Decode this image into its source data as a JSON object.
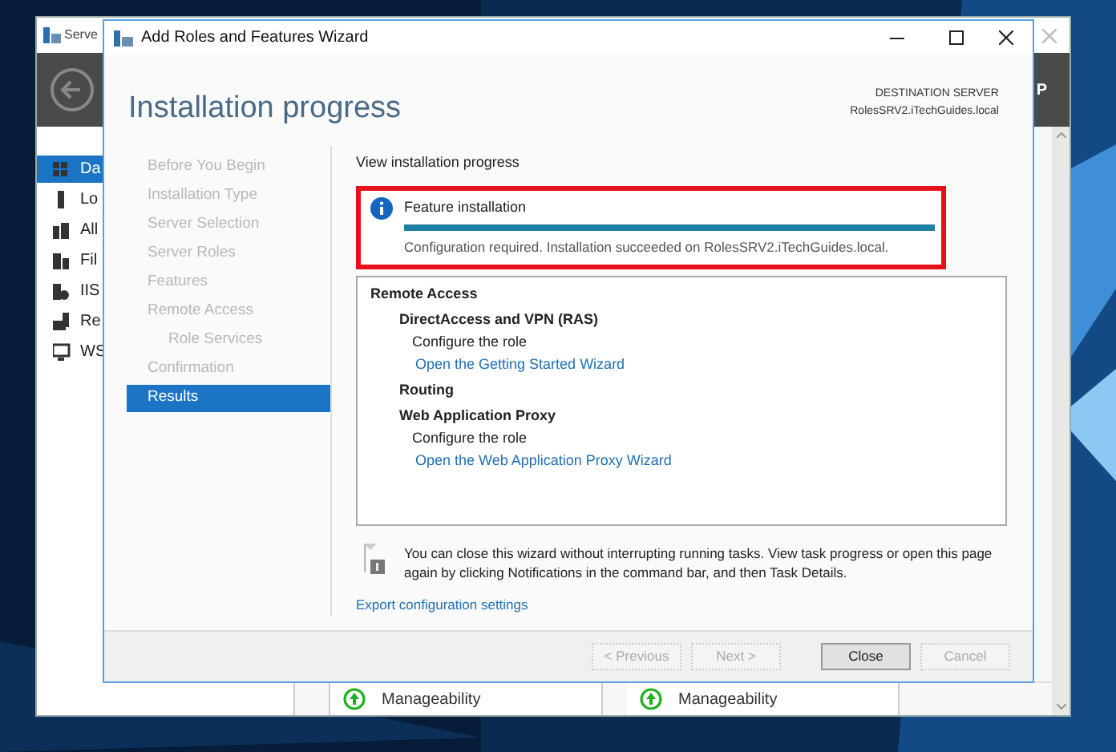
{
  "background_window": {
    "title": "Serve",
    "header_text": "P",
    "sidebar": [
      {
        "label": "Da",
        "selected": true
      },
      {
        "label": "Lo",
        "selected": false
      },
      {
        "label": "All",
        "selected": false
      },
      {
        "label": "Fil",
        "selected": false
      },
      {
        "label": "IIS",
        "selected": false
      },
      {
        "label": "Re",
        "selected": false
      },
      {
        "label": "WS",
        "selected": false
      }
    ],
    "tiles": [
      "Manageability",
      "Manageability"
    ]
  },
  "wizard": {
    "title": "Add Roles and Features Wizard",
    "heading": "Installation progress",
    "destination_label": "DESTINATION SERVER",
    "destination_server": "RolesSRV2.iTechGuides.local",
    "steps": [
      {
        "label": "Before You Begin",
        "selected": false
      },
      {
        "label": "Installation Type",
        "selected": false
      },
      {
        "label": "Server Selection",
        "selected": false
      },
      {
        "label": "Server Roles",
        "selected": false
      },
      {
        "label": "Features",
        "selected": false
      },
      {
        "label": "Remote Access",
        "selected": false,
        "children": [
          {
            "label": "Role Services",
            "selected": false
          }
        ]
      },
      {
        "label": "Confirmation",
        "selected": false
      },
      {
        "label": "Results",
        "selected": true
      }
    ],
    "section_label": "View installation progress",
    "progress": {
      "title": "Feature installation",
      "level": 1,
      "message": "Configuration required. Installation succeeded on RolesSRV2.iTechGuides.local."
    },
    "results": [
      {
        "kind": "heading",
        "text": "Remote Access"
      },
      {
        "kind": "subheading",
        "text": "DirectAccess and VPN (RAS)"
      },
      {
        "kind": "text",
        "text": "Configure the role"
      },
      {
        "kind": "link",
        "text": "Open the Getting Started Wizard"
      },
      {
        "kind": "subheading",
        "text": "Routing"
      },
      {
        "kind": "subheading",
        "text": "Web Application Proxy"
      },
      {
        "kind": "text",
        "text": "Configure the role"
      },
      {
        "kind": "link",
        "text": "Open the Web Application Proxy Wizard"
      }
    ],
    "note": "You can close this wizard without interrupting running tasks. View task progress or open this page again by clicking Notifications in the command bar, and then Task Details.",
    "export_link": "Export configuration settings",
    "buttons": [
      {
        "label": "< Previous",
        "disabled": true
      },
      {
        "label": "Next >",
        "disabled": true
      },
      {
        "label": "Close",
        "disabled": false
      },
      {
        "label": "Cancel",
        "disabled": true
      }
    ]
  }
}
